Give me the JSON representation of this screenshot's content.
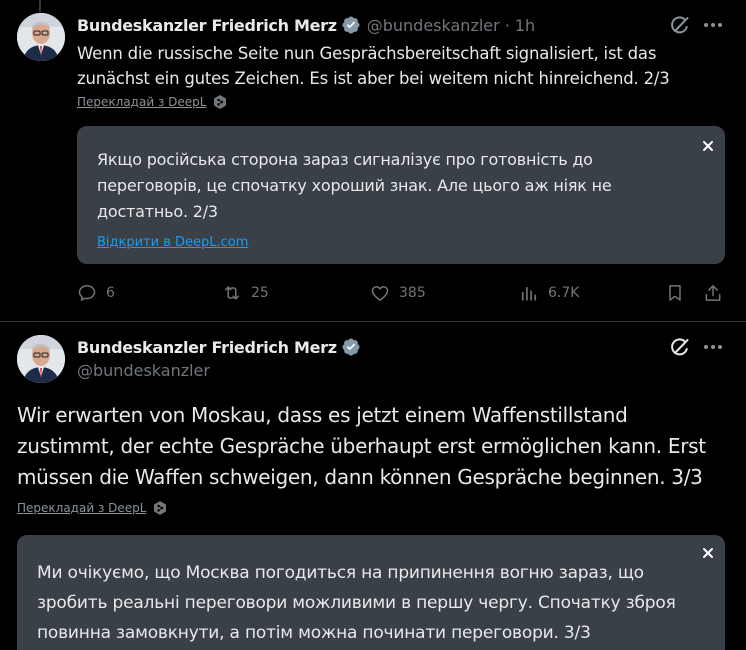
{
  "tweet1": {
    "author_name": "Bundeskanzler Friedrich Merz",
    "handle": "@bundeskanzler",
    "separator": "·",
    "time": "1h",
    "text": "Wenn die russische Seite nun Gesprächsbereitschaft signalisiert, ist das zunächst ein gutes Zeichen. Es ist aber bei weitem nicht hinreichend. 2/3",
    "translate_label": "Перекладай з DeepL",
    "translation_text": "Якщо російська сторона зараз сигналізує про готовність до переговорів, це спочатку хороший знак. Але цього аж ніяк не достатньо. 2/3",
    "open_deepl_label": "Відкрити в DeepL.com",
    "stats": {
      "replies": "6",
      "reposts": "25",
      "likes": "385",
      "views": "6.7K"
    }
  },
  "tweet2": {
    "author_name": "Bundeskanzler Friedrich Merz",
    "handle": "@bundeskanzler",
    "text": "Wir erwarten von Moskau, dass es jetzt einem Waffenstillstand zustimmt, der echte Gespräche überhaupt erst ermöglichen kann. Erst müssen die Waffen schweigen, dann können Gespräche beginnen. 3/3",
    "translate_label": "Перекладай з DeepL",
    "translation_text": "Ми очікуємо, що Москва погодиться на припинення вогню зараз, що зробить реальні переговори можливими в першу чергу. Спочатку зброя повинна замовкнути, а потім можна починати переговори. 3/3"
  },
  "colors": {
    "background": "#000000",
    "text_primary": "#e7e9ea",
    "text_secondary": "#71767b",
    "link": "#1d9bf0",
    "verified": "#829aab",
    "translation_box": "#3a4047"
  },
  "icons": [
    "verified-badge-icon",
    "grok-icon",
    "more-icon",
    "deepl-icon",
    "close-icon",
    "reply-icon",
    "repost-icon",
    "like-icon",
    "views-icon",
    "bookmark-icon",
    "share-icon"
  ]
}
